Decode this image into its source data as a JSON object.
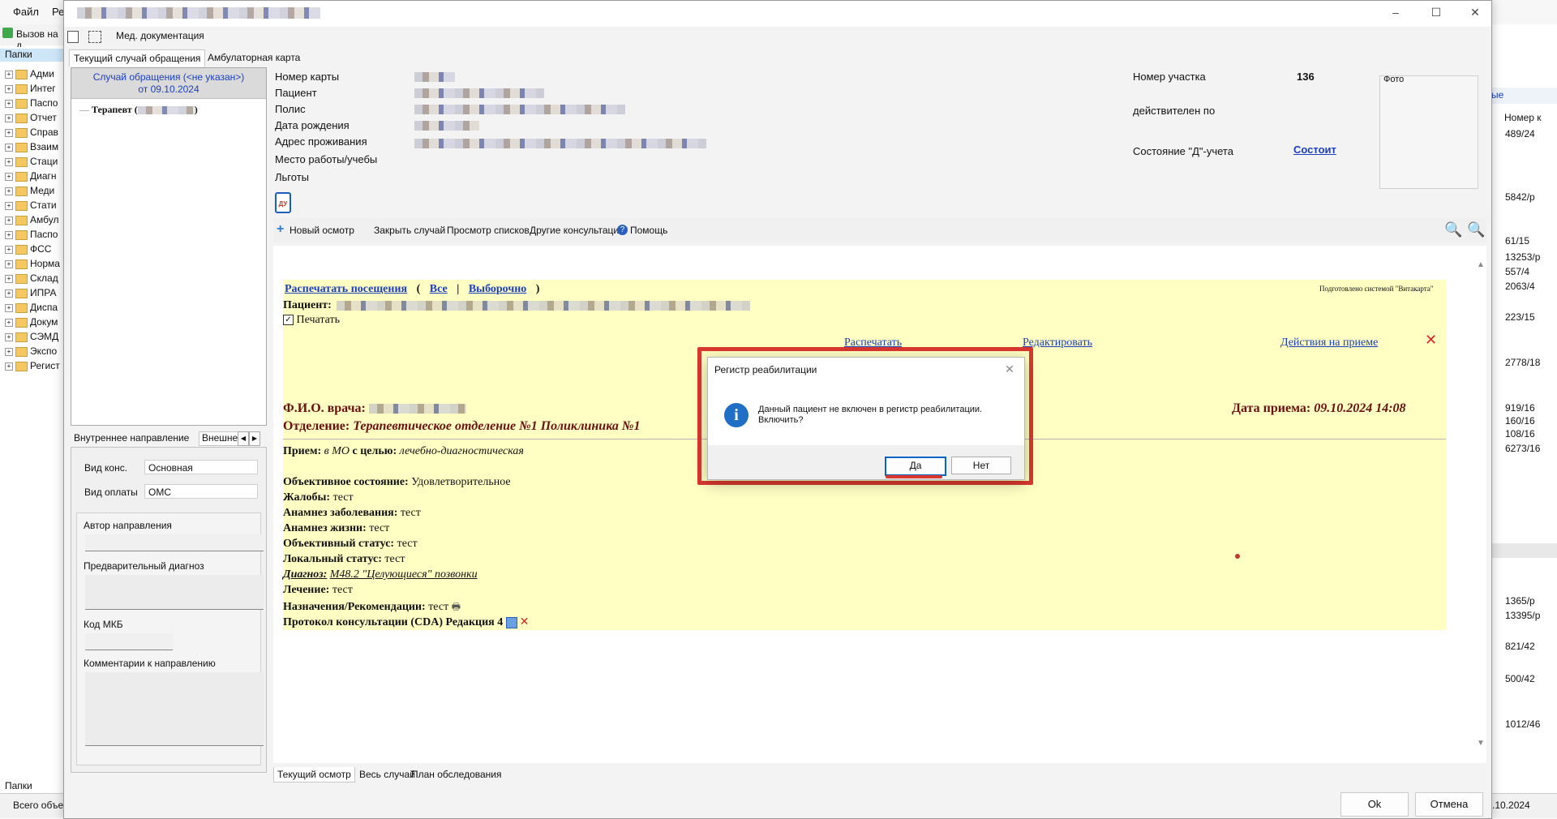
{
  "bg_app": {
    "menu": [
      "Файл",
      "Ре"
    ],
    "toolbar_label": "Вызов на д",
    "left_tab": "Папки",
    "tree": [
      "Адми",
      "Интег",
      "Паспо",
      "Отчет",
      "Справ",
      "Взаим",
      "Стаци",
      "Диагн",
      "Меди",
      "Стати",
      "Амбул",
      "Паспо",
      "ФСС",
      "Норма",
      "Склад",
      "ИПРА",
      "Диспа",
      "Докум",
      "СЭМД",
      "Экспо",
      "Регист"
    ],
    "bottom_tab": "Папки",
    "status_text": "Всего объе",
    "right_header_fragment": "ые",
    "right_col_header": "Номер к",
    "right_cells": [
      "489/24",
      "5842/р",
      "61/15",
      "13253/р",
      "557/4",
      "2063/4",
      "223/15",
      "2778/18",
      "919/16",
      "160/16",
      "108/16",
      "6273/16",
      "1365/р",
      "13395/р",
      "821/42",
      "500/42",
      "1012/46"
    ],
    "right_date": ".10.2024"
  },
  "window": {
    "toolbar_label": "Мед. документация",
    "tabs": [
      "Текущий случай обращения",
      "Амбулаторная карта"
    ],
    "case": {
      "title_line1": "Случай обращения (<не указан>)",
      "title_line2": "от 09.10.2024",
      "item": "Терапевт (",
      "item_tail": ")"
    },
    "referral": {
      "tabs": [
        "Внутреннее направление",
        "Внешне"
      ],
      "vid_kons_label": "Вид конс.",
      "vid_kons_value": "Основная",
      "vid_oplaty_label": "Вид оплаты",
      "vid_oplaty_value": "ОМС",
      "author_label": "Автор направления",
      "diag_label": "Предварительный диагноз",
      "mkb_label": "Код МКБ",
      "comments_label": "Комментарии к направлению"
    },
    "patient_labels": [
      "Номер карты",
      "Пациент",
      "Полис",
      "Дата рождения",
      "Адрес проживания",
      "Место работы/учебы",
      "Льготы"
    ],
    "uchastok_label": "Номер участка",
    "uchastok_value": "136",
    "valid_label": "действителен по",
    "d_state_label": "Состояние \"Д\"-учета",
    "d_state_value": "Состоит",
    "photo_label": "Фото",
    "du_icon_text": "ДУ",
    "actions": [
      "Новый осмотр",
      "Закрыть случай",
      "Просмотр списков",
      "Другие консультации",
      "Помощь"
    ],
    "bottom_tabs": [
      "Текущий осмотр",
      "Весь случай",
      "План обследования"
    ],
    "ok_label": "Ok",
    "cancel_label": "Отмена"
  },
  "document": {
    "print_visits": "Распечатать посещения",
    "paren_open": "(",
    "all": "Все",
    "sep": "|",
    "selective": "Выборочно",
    "paren_close": ")",
    "prepared_by": "Подготовлено системой \"Витакарта\"",
    "patient_label": "Пациент:",
    "print_checkbox": "Печатать",
    "link_print": "Распечатать",
    "link_edit": "Редактировать",
    "link_actions": "Действия на приеме",
    "doctor_label": "Ф.И.О. врача:",
    "date_label": "Дата приема:",
    "date_value": "09.10.2024 14:08",
    "dept_label": "Отделение:",
    "dept_value": "Терапевтическое отделение №1 Поликлиника №1",
    "visit_label": "Прием:",
    "visit_place": "в МО",
    "visit_goal_label": "с целью:",
    "visit_goal": "лечебно-диагностическая",
    "rows": [
      {
        "label": "Объективное состояние:",
        "value": "Удовлетворительное"
      },
      {
        "label": "Жалобы:",
        "value": "тест"
      },
      {
        "label": "Анамнез заболевания:",
        "value": "тест"
      },
      {
        "label": "Анамнез жизни:",
        "value": "тест"
      },
      {
        "label": "Объективный статус:",
        "value": "тест"
      },
      {
        "label": "Локальный статус:",
        "value": "тест"
      }
    ],
    "diagnosis_label": "Диагноз:",
    "diagnosis_value": "M48.2 \"Целующиеся\" позвонки",
    "treatment_label": "Лечение:",
    "treatment_value": "тест",
    "recommend_label": "Назначения/Рекомендации:",
    "recommend_value": "тест",
    "protocol": "Протокол консультации (CDA) Редакция 4"
  },
  "dialog": {
    "title": "Регистр реабилитации",
    "message": "Данный пациент не включен в регистр реабилитации. Включить?",
    "yes": "Да",
    "no": "Нет"
  },
  "colors": {
    "highlight": "#d9382f",
    "link": "#1b3fbf",
    "doc_bg": "#ffffc4"
  }
}
